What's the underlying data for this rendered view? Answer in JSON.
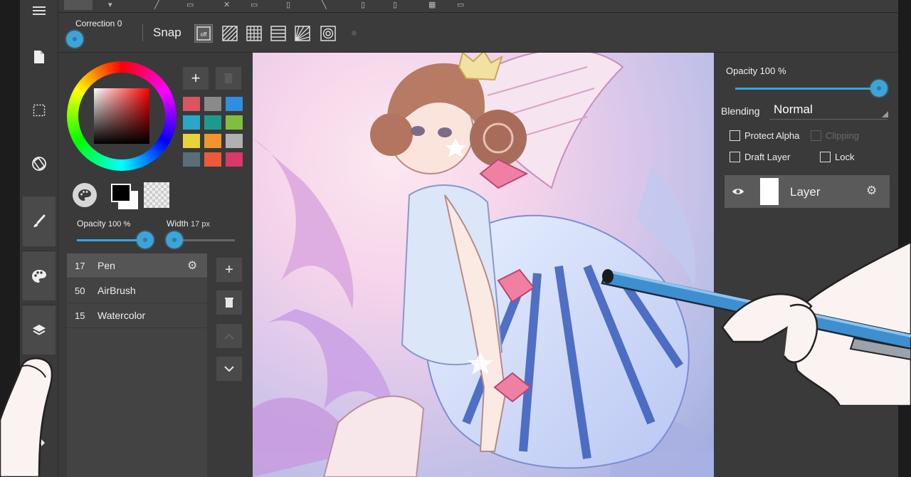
{
  "colors": {
    "accent": "#3da4d8",
    "panel": "#3a3a3a",
    "active_row": "#555555"
  },
  "left_toolbar": {
    "items": [
      {
        "icon": "menu-icon"
      },
      {
        "icon": "new-file-icon"
      },
      {
        "icon": "selection-icon"
      },
      {
        "icon": "rotate-icon"
      },
      {
        "icon": "brush-icon"
      },
      {
        "icon": "palette-icon"
      },
      {
        "icon": "layers-icon"
      },
      {
        "icon": "redo-icon"
      }
    ]
  },
  "top_toolbar": {
    "correction_label": "Correction 0",
    "snap_label": "Snap",
    "snap_off_label": "off",
    "snap_modes": [
      "snap-off",
      "parallel-snap",
      "grid-snap",
      "horizontal-snap",
      "radial-snap",
      "circle-snap"
    ]
  },
  "color_panel": {
    "add_label": "+",
    "swatches": [
      "#d9555f",
      "#8a8a8a",
      "#2f8fe0",
      "#2aa7c8",
      "#1e9a8c",
      "#7fbf3f",
      "#e8d43a",
      "#f0962a",
      "#b0b0b0",
      "#5a6e78",
      "#ec5a3a",
      "#d9386a"
    ],
    "foreground": "#000000",
    "background": "#ffffff"
  },
  "brush_settings": {
    "opacity_label": "Opacity",
    "opacity_value": "100 %",
    "opacity_fraction": 1.0,
    "width_label": "Width",
    "width_value": "17 px"
  },
  "brushes": [
    {
      "size": "17",
      "name": "Pen",
      "active": true
    },
    {
      "size": "50",
      "name": "AirBrush",
      "active": false
    },
    {
      "size": "15",
      "name": "Watercolor",
      "active": false
    }
  ],
  "layer_panel": {
    "opacity_label": "Opacity 100 %",
    "opacity_fraction": 1.0,
    "blending_label": "Blending",
    "blending_value": "Normal",
    "protect_alpha_label": "Protect Alpha",
    "clipping_label": "Clipping",
    "draft_layer_label": "Draft Layer",
    "lock_label": "Lock",
    "layers": [
      {
        "name": "Layer",
        "visible": true
      }
    ]
  }
}
